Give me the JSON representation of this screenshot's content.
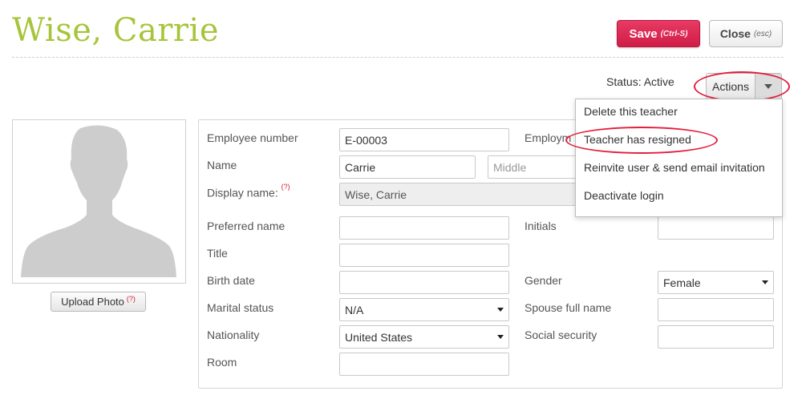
{
  "header": {
    "title": "Wise, Carrie",
    "save_label": "Save",
    "save_hint": "(Ctrl-S)",
    "close_label": "Close",
    "close_hint": "(esc)"
  },
  "status": {
    "text": "Status: Active",
    "actions_label": "Actions"
  },
  "actions_menu": {
    "items": [
      "Delete this teacher",
      "Teacher has resigned",
      "Reinvite user & send email invitation",
      "Deactivate login"
    ]
  },
  "photo": {
    "upload_label": "Upload Photo",
    "help_mark": "(?)"
  },
  "form": {
    "employee_number": {
      "label": "Employee number",
      "value": "E-00003"
    },
    "employment": {
      "label": "Employm"
    },
    "name": {
      "label": "Name",
      "first": "Carrie",
      "middle_placeholder": "Middle"
    },
    "display_name": {
      "label": "Display name:",
      "help": "(?)",
      "value": "Wise, Carrie"
    },
    "preferred_name": {
      "label": "Preferred name",
      "value": ""
    },
    "initials": {
      "label": "Initials",
      "value": ""
    },
    "title": {
      "label": "Title",
      "value": ""
    },
    "birth_date": {
      "label": "Birth date",
      "value": ""
    },
    "gender": {
      "label": "Gender",
      "value": "Female"
    },
    "marital_status": {
      "label": "Marital status",
      "value": "N/A"
    },
    "spouse_full_name": {
      "label": "Spouse full name",
      "value": ""
    },
    "nationality": {
      "label": "Nationality",
      "value": "United States"
    },
    "social_security": {
      "label": "Social security",
      "value": ""
    },
    "room": {
      "label": "Room",
      "value": ""
    }
  },
  "colors": {
    "title": "#a7c43a",
    "save_button": "#d8234f",
    "highlight": "#e31e3c"
  }
}
